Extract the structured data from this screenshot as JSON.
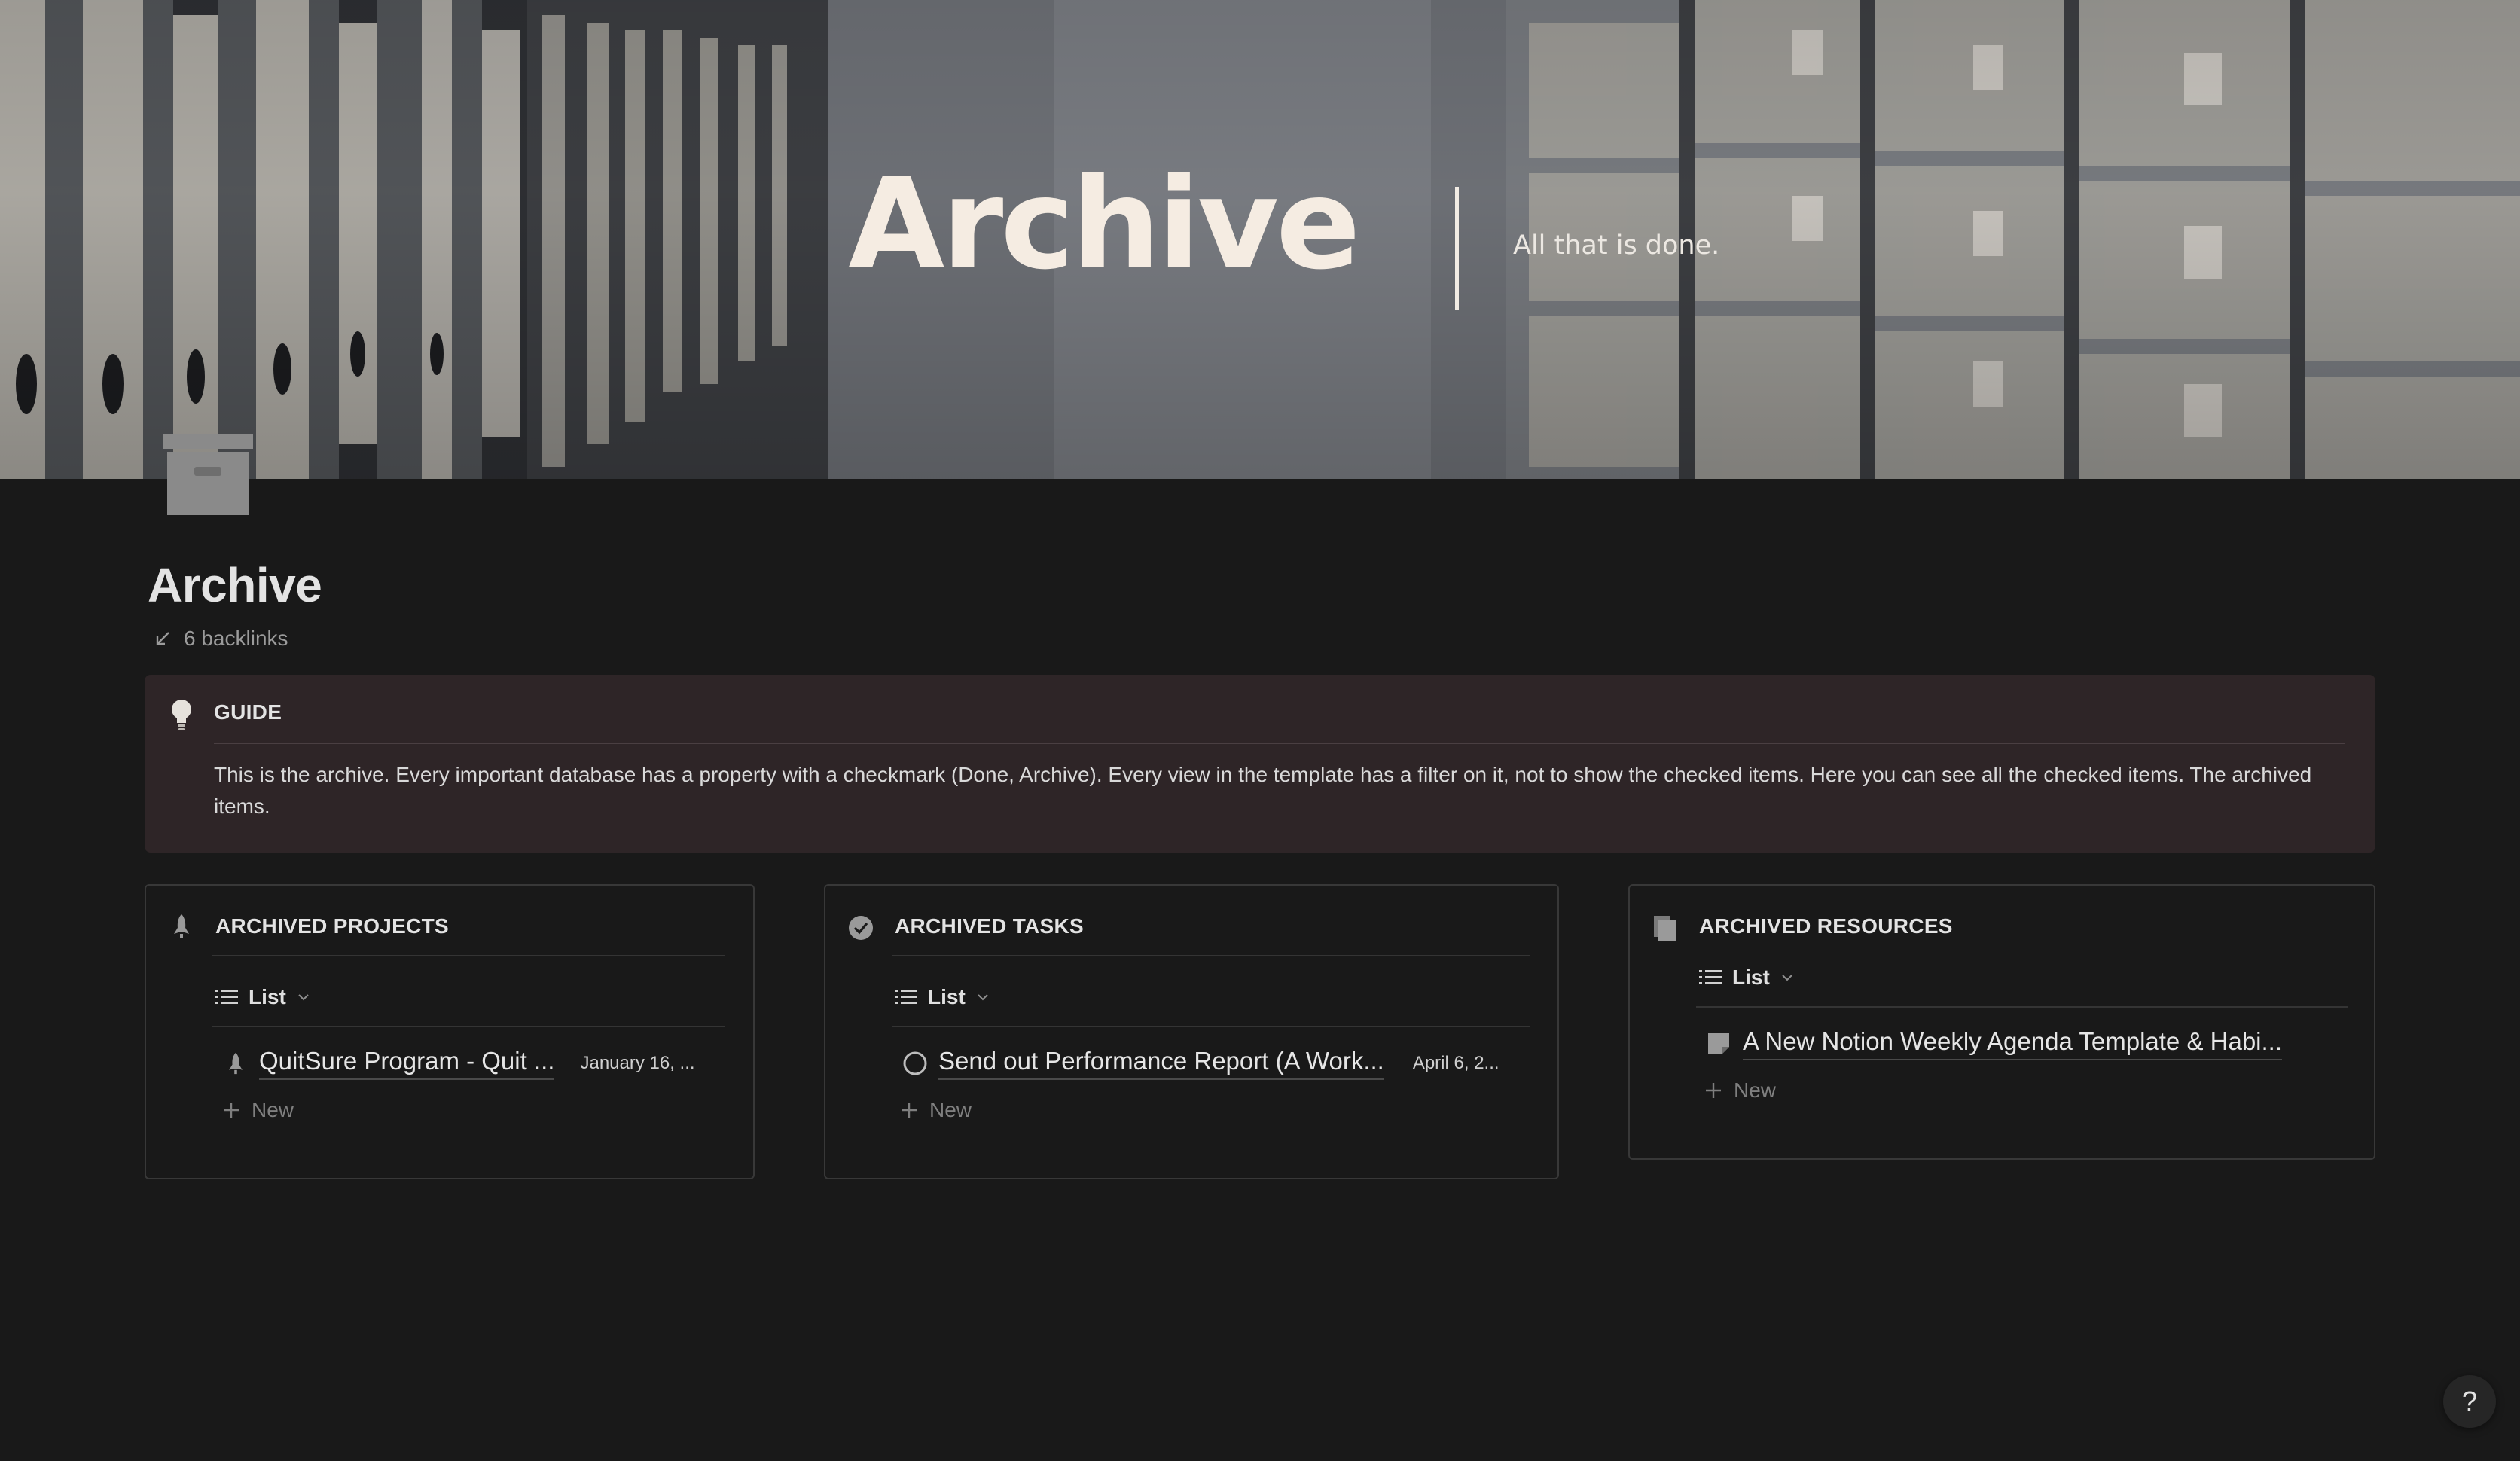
{
  "cover": {
    "title": "Archive",
    "subtitle": "All that is done."
  },
  "page": {
    "icon": "archive-box-icon",
    "title": "Archive",
    "backlinks": "6 backlinks"
  },
  "guide": {
    "icon": "lightbulb-icon",
    "title": "GUIDE",
    "text": "This is the archive. Every important database has a property with a checkmark (Done, Archive). Every view in the template has a filter on it, not to show the checked items. Here you can see all the checked items. The archived items."
  },
  "databases": [
    {
      "icon": "rocket-icon",
      "title": "ARCHIVED PROJECTS",
      "view": "List",
      "items": [
        {
          "icon": "rocket-icon",
          "name": "QuitSure Program - Quit ...",
          "date": "January 16, ..."
        }
      ],
      "new_label": "New"
    },
    {
      "icon": "check-circle-icon",
      "title": "ARCHIVED TASKS",
      "view": "List",
      "items": [
        {
          "icon": "empty-circle-icon",
          "name": "Send out Performance Report (A Work...",
          "date": "April 6, 2..."
        }
      ],
      "new_label": "New"
    },
    {
      "icon": "stacked-docs-icon",
      "title": "ARCHIVED RESOURCES",
      "view": "List",
      "items": [
        {
          "icon": "note-icon",
          "name": "A New Notion Weekly Agenda Template & Habi...",
          "date": ""
        }
      ],
      "new_label": "New"
    }
  ],
  "help": {
    "label": "?"
  },
  "colors": {
    "background": "#191919",
    "callout": "#2e2527",
    "cover_text": "#f5ece2",
    "border": "#383838"
  }
}
